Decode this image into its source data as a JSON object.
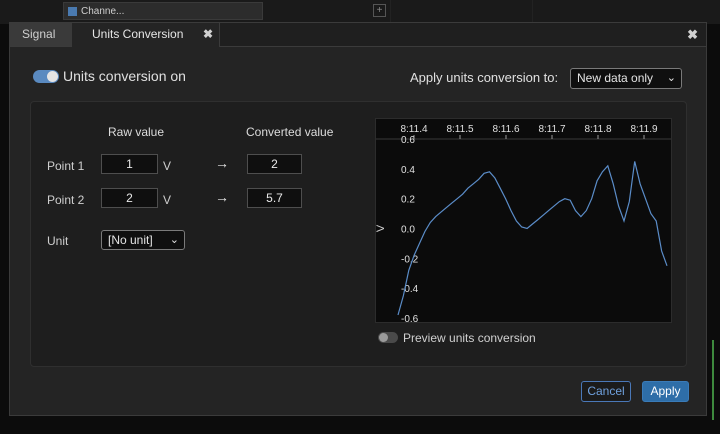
{
  "background": {
    "tab_label": "Channe...",
    "plus_label": "+"
  },
  "dialog": {
    "tabs": [
      {
        "label": "Signal"
      },
      {
        "label": "Units Conversion"
      }
    ],
    "tab_close": "✖",
    "dialog_close": "✖",
    "conversion_toggle": {
      "label": "Units conversion on",
      "on": true
    },
    "apply_to": {
      "label": "Apply units conversion to:",
      "selected": "New data only"
    },
    "table": {
      "raw_header": "Raw value",
      "converted_header": "Converted value",
      "rows": [
        {
          "label": "Point 1",
          "raw": "1",
          "unit": "V",
          "arrow": "→",
          "converted": "2"
        },
        {
          "label": "Point 2",
          "raw": "2",
          "unit": "V",
          "arrow": "→",
          "converted": "5.7"
        }
      ],
      "unit_label": "Unit",
      "unit_selected": "[No unit]"
    },
    "preview": {
      "label": "Preview units conversion",
      "on": false
    },
    "buttons": {
      "cancel": "Cancel",
      "apply": "Apply"
    }
  },
  "colors": {
    "accent": "#2e6ea8",
    "line": "#5b8dc9",
    "toggle_on": "#5a8ac0"
  },
  "chart_data": {
    "type": "line",
    "title": "",
    "xlabel": "",
    "ylabel": "V",
    "x_ticks": [
      "8:11.4",
      "8:11.5",
      "8:11.6",
      "8:11.7",
      "8:11.8",
      "8:11.9"
    ],
    "y_ticks": [
      "0.6",
      "0.4",
      "0.2",
      "0.0",
      "-0.2",
      "-0.4",
      "-0.6"
    ],
    "ylim": [
      -0.6,
      0.6
    ],
    "xlim": [
      0,
      1
    ],
    "grid": false,
    "series": [
      {
        "values": [
          [
            0.0,
            -0.58
          ],
          [
            0.02,
            -0.45
          ],
          [
            0.04,
            -0.28
          ],
          [
            0.06,
            -0.18
          ],
          [
            0.08,
            -0.1
          ],
          [
            0.1,
            -0.02
          ],
          [
            0.12,
            0.04
          ],
          [
            0.14,
            0.08
          ],
          [
            0.16,
            0.11
          ],
          [
            0.18,
            0.14
          ],
          [
            0.2,
            0.17
          ],
          [
            0.22,
            0.2
          ],
          [
            0.24,
            0.23
          ],
          [
            0.26,
            0.27
          ],
          [
            0.28,
            0.3
          ],
          [
            0.3,
            0.33
          ],
          [
            0.32,
            0.37
          ],
          [
            0.34,
            0.38
          ],
          [
            0.36,
            0.34
          ],
          [
            0.38,
            0.27
          ],
          [
            0.4,
            0.2
          ],
          [
            0.42,
            0.12
          ],
          [
            0.44,
            0.05
          ],
          [
            0.46,
            0.01
          ],
          [
            0.48,
            0.0
          ],
          [
            0.5,
            0.03
          ],
          [
            0.52,
            0.06
          ],
          [
            0.54,
            0.09
          ],
          [
            0.56,
            0.12
          ],
          [
            0.58,
            0.15
          ],
          [
            0.6,
            0.18
          ],
          [
            0.62,
            0.2
          ],
          [
            0.64,
            0.19
          ],
          [
            0.66,
            0.12
          ],
          [
            0.68,
            0.08
          ],
          [
            0.7,
            0.12
          ],
          [
            0.72,
            0.2
          ],
          [
            0.74,
            0.32
          ],
          [
            0.76,
            0.38
          ],
          [
            0.78,
            0.42
          ],
          [
            0.8,
            0.3
          ],
          [
            0.82,
            0.15
          ],
          [
            0.84,
            0.05
          ],
          [
            0.86,
            0.18
          ],
          [
            0.88,
            0.45
          ],
          [
            0.9,
            0.3
          ],
          [
            0.92,
            0.2
          ],
          [
            0.94,
            0.1
          ],
          [
            0.96,
            0.05
          ],
          [
            0.98,
            -0.15
          ],
          [
            1.0,
            -0.25
          ]
        ]
      }
    ]
  }
}
